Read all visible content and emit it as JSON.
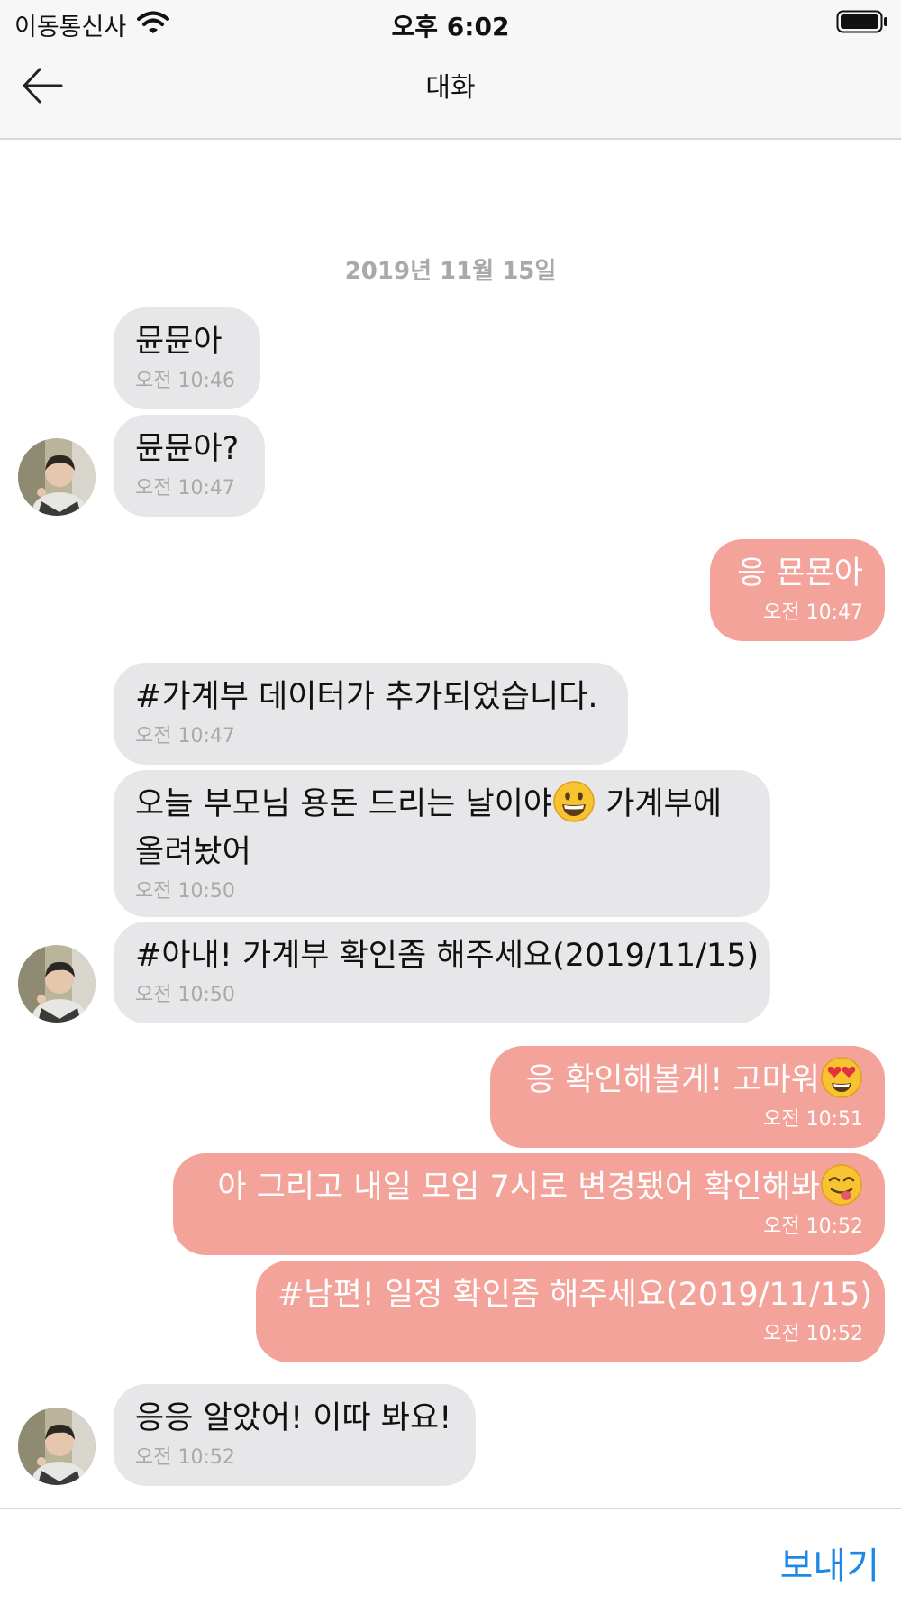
{
  "status_bar": {
    "carrier": "이동통신사",
    "time": "오후 6:02"
  },
  "nav": {
    "title": "대화"
  },
  "date_separator": "2019년 11월 15일",
  "messages": [
    {
      "from": "other",
      "text": "뮨뮨아",
      "time": "오전 10:46"
    },
    {
      "from": "other",
      "text": "뮨뮨아?",
      "time": "오전 10:47"
    },
    {
      "from": "me",
      "text": "응 묜묜아",
      "time": "오전 10:47"
    },
    {
      "from": "other",
      "text": "#가계부 데이터가 추가되었습니다.",
      "time": "오전 10:47"
    },
    {
      "from": "other",
      "text": "오늘 부모님 용돈 드리는 날이야",
      "text_after_emoji": " 가계부에",
      "text_line2": "올려놨어",
      "emoji": "grinning-face",
      "time": "오전 10:50"
    },
    {
      "from": "other",
      "text": "#아내! 가계부 확인좀 해주세요(2019/11/15)",
      "time": "오전 10:50"
    },
    {
      "from": "me",
      "text": "응 확인해볼게! 고마워",
      "emoji": "heart-eyes-face",
      "time": "오전 10:51"
    },
    {
      "from": "me",
      "text": "아 그리고 내일 모임 7시로 변경됐어 확인해봐",
      "emoji": "yum-face",
      "time": "오전 10:52"
    },
    {
      "from": "me",
      "text": "#남편! 일정 확인좀 해주세요(2019/11/15)",
      "time": "오전 10:52"
    },
    {
      "from": "other",
      "text": "응응 알았어! 이따 봐요!",
      "time": "오전 10:52"
    }
  ],
  "input": {
    "value": "",
    "send_label": "보내기"
  },
  "colors": {
    "incoming_bubble": "#e7e7e9",
    "outgoing_bubble": "#f4a39b",
    "send": "#1e88e5",
    "date": "#a9a9a9"
  }
}
